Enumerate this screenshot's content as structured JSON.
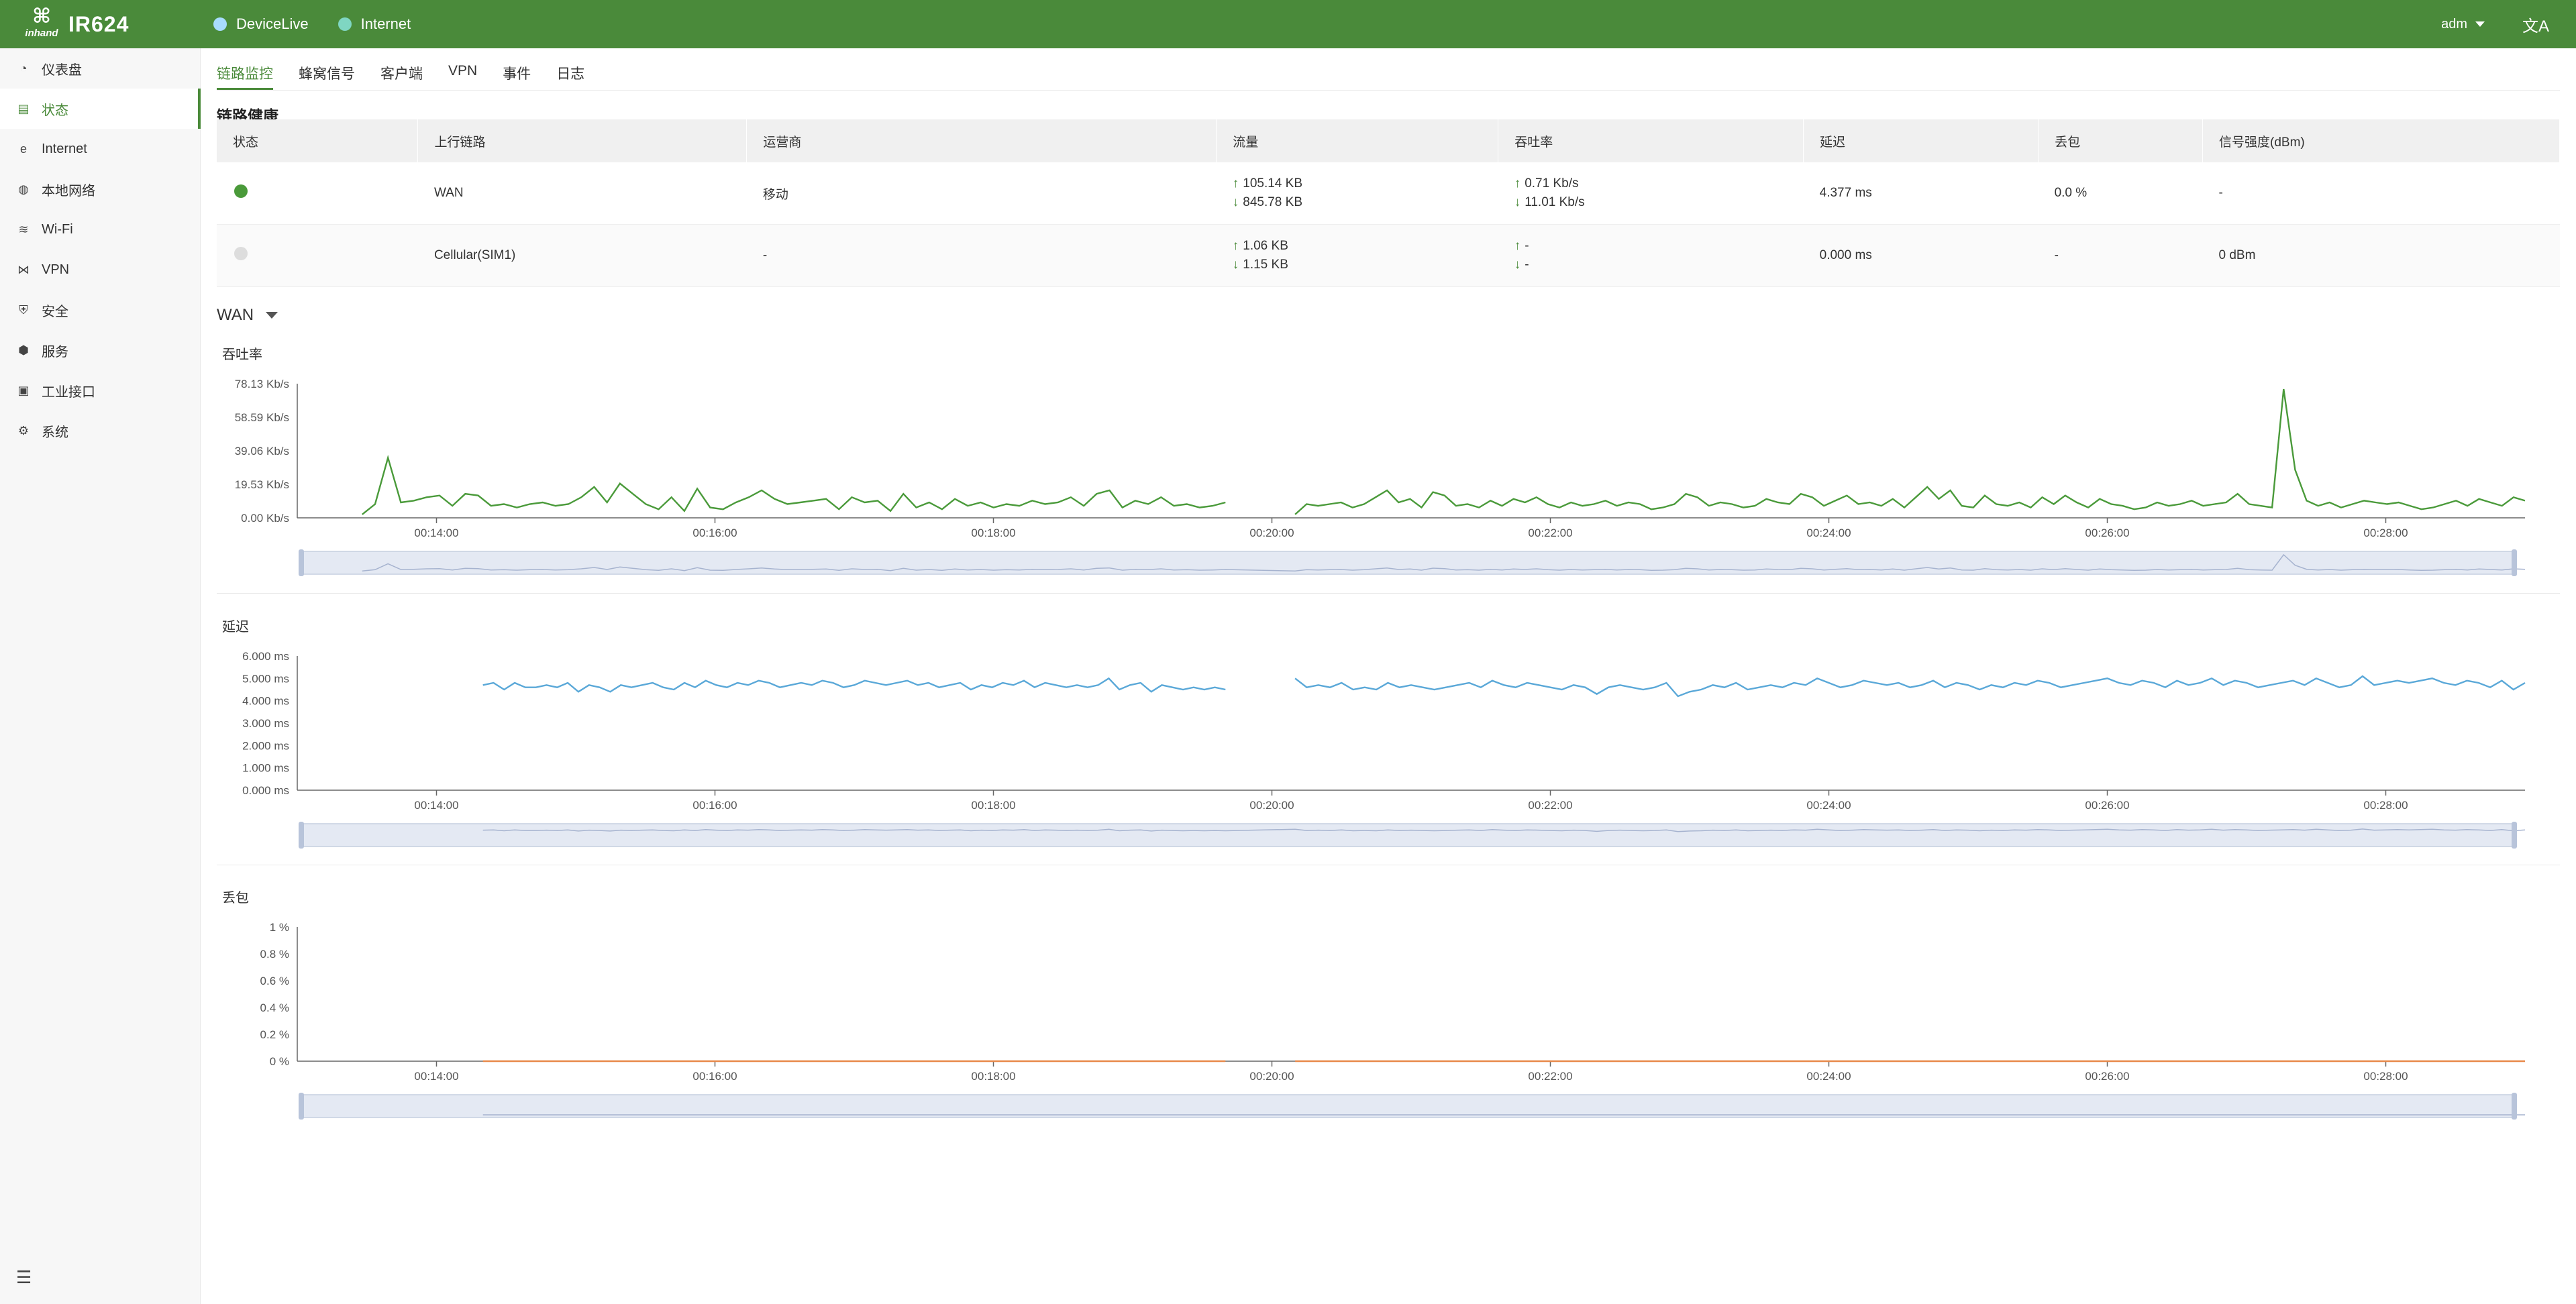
{
  "header": {
    "logo_top": "⌘",
    "logo_text": "inhand",
    "title": "IR624",
    "pills": [
      {
        "label": "DeviceLive",
        "color": "#a8dcff"
      },
      {
        "label": "Internet",
        "color": "#7fd6c2"
      }
    ],
    "user": "adm",
    "lang_icon": "文A"
  },
  "sidebar": {
    "items": [
      {
        "label": "仪表盘",
        "icon": "dashboard-icon",
        "glyph": "◔"
      },
      {
        "label": "状态",
        "icon": "status-icon",
        "glyph": "▤"
      },
      {
        "label": "Internet",
        "icon": "internet-icon",
        "glyph": "e"
      },
      {
        "label": "本地网络",
        "icon": "lan-icon",
        "glyph": "◍"
      },
      {
        "label": "Wi-Fi",
        "icon": "wifi-icon",
        "glyph": "≋"
      },
      {
        "label": "VPN",
        "icon": "vpn-icon",
        "glyph": "⋈"
      },
      {
        "label": "安全",
        "icon": "shield-icon",
        "glyph": "⛨"
      },
      {
        "label": "服务",
        "icon": "service-icon",
        "glyph": "⬢"
      },
      {
        "label": "工业接口",
        "icon": "industrial-icon",
        "glyph": "▣"
      },
      {
        "label": "系统",
        "icon": "gear-icon",
        "glyph": "⚙"
      }
    ],
    "active_index": 1,
    "collapse_icon": "☰"
  },
  "tabs": [
    {
      "label": "链路监控",
      "active": true
    },
    {
      "label": "蜂窝信号",
      "active": false
    },
    {
      "label": "客户端",
      "active": false
    },
    {
      "label": "VPN",
      "active": false
    },
    {
      "label": "事件",
      "active": false
    },
    {
      "label": "日志",
      "active": false
    }
  ],
  "health": {
    "title": "链路健康",
    "columns": [
      "状态",
      "上行链路",
      "运营商",
      "流量",
      "吞吐率",
      "延迟",
      "丢包",
      "信号强度(dBm)"
    ],
    "rows": [
      {
        "status_color": "#4a9a3a",
        "uplink": "WAN",
        "carrier": "移动",
        "traffic_up": "105.14 KB",
        "traffic_down": "845.78 KB",
        "thr_up": "0.71 Kb/s",
        "thr_down": "11.01 Kb/s",
        "latency": "4.377 ms",
        "loss": "0.0 %",
        "signal": "-"
      },
      {
        "status_color": "#dddddd",
        "uplink": "Cellular(SIM1)",
        "carrier": "-",
        "traffic_up": "1.06 KB",
        "traffic_down": "1.15 KB",
        "thr_up": "-",
        "thr_down": "-",
        "latency": "0.000 ms",
        "loss": "-",
        "signal": "0 dBm"
      }
    ]
  },
  "wan_select": "WAN",
  "charts": {
    "x_ticks": [
      "00:14:00",
      "00:16:00",
      "00:18:00",
      "00:20:00",
      "00:22:00",
      "00:24:00",
      "00:26:00",
      "00:28:00"
    ],
    "throughput_title": "吞吐率",
    "latency_title": "延迟",
    "loss_title": "丢包"
  },
  "chart_data": [
    {
      "type": "line",
      "title": "吞吐率",
      "series_color": "#4a9a3a",
      "x_range": [
        "00:13:00",
        "00:29:00"
      ],
      "ylim": [
        0,
        78.13
      ],
      "y_ticks": [
        "0.00 Kb/s",
        "19.53 Kb/s",
        "39.06 Kb/s",
        "58.59 Kb/s",
        "78.13 Kb/s"
      ],
      "y_tick_values": [
        0,
        19.53,
        39.06,
        58.59,
        78.13
      ],
      "segments": [
        {
          "start": "00:13:28",
          "end": "00:19:40",
          "values": [
            2,
            8,
            35,
            9,
            10,
            12,
            13,
            7,
            14,
            13,
            7,
            8,
            6,
            8,
            9,
            7,
            8,
            12,
            18,
            9,
            20,
            14,
            8,
            5,
            12,
            4,
            17,
            6,
            5,
            9,
            12,
            16,
            11,
            8,
            9,
            10,
            11,
            5,
            12,
            9,
            10,
            4,
            14,
            6,
            9,
            5,
            11,
            7,
            9,
            6,
            8,
            7,
            10,
            8,
            9,
            12,
            7,
            14,
            16,
            6,
            10,
            8,
            12,
            7,
            8,
            6,
            7,
            9
          ]
        },
        {
          "start": "00:20:10",
          "end": "00:29:00",
          "values": [
            2,
            8,
            7,
            8,
            9,
            6,
            8,
            12,
            16,
            9,
            11,
            6,
            15,
            13,
            7,
            8,
            6,
            10,
            7,
            11,
            9,
            12,
            8,
            6,
            9,
            7,
            8,
            10,
            7,
            9,
            8,
            5,
            6,
            8,
            14,
            12,
            7,
            9,
            8,
            6,
            7,
            11,
            9,
            8,
            14,
            12,
            7,
            10,
            13,
            8,
            9,
            7,
            11,
            6,
            12,
            18,
            11,
            16,
            7,
            6,
            13,
            8,
            7,
            9,
            6,
            12,
            8,
            13,
            9,
            6,
            11,
            8,
            7,
            5,
            6,
            9,
            7,
            8,
            10,
            7,
            8,
            9,
            14,
            8,
            7,
            6,
            75,
            28,
            10,
            7,
            9,
            6,
            8,
            10,
            9,
            8,
            9,
            7,
            5,
            6,
            8,
            10,
            7,
            11,
            9,
            7,
            12,
            10
          ]
        }
      ]
    },
    {
      "type": "line",
      "title": "延迟",
      "series_color": "#5aa8d8",
      "x_range": [
        "00:13:00",
        "00:29:00"
      ],
      "ylim": [
        0,
        6
      ],
      "y_ticks": [
        "0.000 ms",
        "1.000 ms",
        "2.000 ms",
        "3.000 ms",
        "4.000 ms",
        "5.000 ms",
        "6.000 ms"
      ],
      "y_tick_values": [
        0,
        1,
        2,
        3,
        4,
        5,
        6
      ],
      "segments": [
        {
          "start": "00:14:20",
          "end": "00:19:40",
          "values": [
            4.7,
            4.8,
            4.5,
            4.8,
            4.6,
            4.6,
            4.7,
            4.6,
            4.8,
            4.4,
            4.7,
            4.6,
            4.4,
            4.7,
            4.6,
            4.7,
            4.8,
            4.6,
            4.5,
            4.8,
            4.6,
            4.9,
            4.7,
            4.6,
            4.8,
            4.7,
            4.9,
            4.8,
            4.6,
            4.7,
            4.8,
            4.7,
            4.9,
            4.8,
            4.6,
            4.7,
            4.9,
            4.8,
            4.7,
            4.8,
            4.9,
            4.7,
            4.8,
            4.6,
            4.7,
            4.8,
            4.5,
            4.7,
            4.6,
            4.8,
            4.7,
            4.9,
            4.6,
            4.8,
            4.7,
            4.6,
            4.7,
            4.6,
            4.7,
            5.0,
            4.5,
            4.7,
            4.8,
            4.4,
            4.7,
            4.6,
            4.5,
            4.6,
            4.5,
            4.6,
            4.5
          ]
        },
        {
          "start": "00:20:10",
          "end": "00:29:00",
          "values": [
            5.0,
            4.6,
            4.7,
            4.6,
            4.8,
            4.5,
            4.6,
            4.5,
            4.8,
            4.6,
            4.7,
            4.6,
            4.5,
            4.6,
            4.7,
            4.8,
            4.6,
            4.9,
            4.7,
            4.6,
            4.8,
            4.7,
            4.6,
            4.5,
            4.7,
            4.6,
            4.3,
            4.6,
            4.7,
            4.6,
            4.5,
            4.6,
            4.8,
            4.2,
            4.4,
            4.5,
            4.7,
            4.6,
            4.8,
            4.5,
            4.6,
            4.7,
            4.6,
            4.8,
            4.7,
            5.0,
            4.8,
            4.6,
            4.7,
            4.9,
            4.8,
            4.7,
            4.8,
            4.6,
            4.7,
            4.9,
            4.6,
            4.8,
            4.7,
            4.5,
            4.7,
            4.6,
            4.8,
            4.7,
            4.9,
            4.8,
            4.6,
            4.7,
            4.8,
            4.9,
            5.0,
            4.8,
            4.7,
            4.9,
            4.8,
            4.6,
            4.9,
            4.7,
            4.8,
            5.0,
            4.7,
            4.9,
            4.8,
            4.6,
            4.7,
            4.8,
            4.9,
            4.7,
            5.0,
            4.8,
            4.6,
            4.7,
            5.1,
            4.7,
            4.8,
            4.9,
            4.8,
            4.9,
            5.0,
            4.8,
            4.7,
            4.9,
            4.8,
            4.6,
            4.9,
            4.5,
            4.8
          ]
        }
      ]
    },
    {
      "type": "line",
      "title": "丢包",
      "series_color": "#e8894a",
      "x_range": [
        "00:13:00",
        "00:29:00"
      ],
      "ylim": [
        0,
        1
      ],
      "y_ticks": [
        "0 %",
        "0.2 %",
        "0.4 %",
        "0.6 %",
        "0.8 %",
        "1 %"
      ],
      "y_tick_values": [
        0,
        0.2,
        0.4,
        0.6,
        0.8,
        1
      ],
      "segments": [
        {
          "start": "00:14:20",
          "end": "00:19:40",
          "values": [
            0,
            0
          ]
        },
        {
          "start": "00:20:10",
          "end": "00:29:00",
          "values": [
            0,
            0
          ]
        }
      ]
    }
  ]
}
